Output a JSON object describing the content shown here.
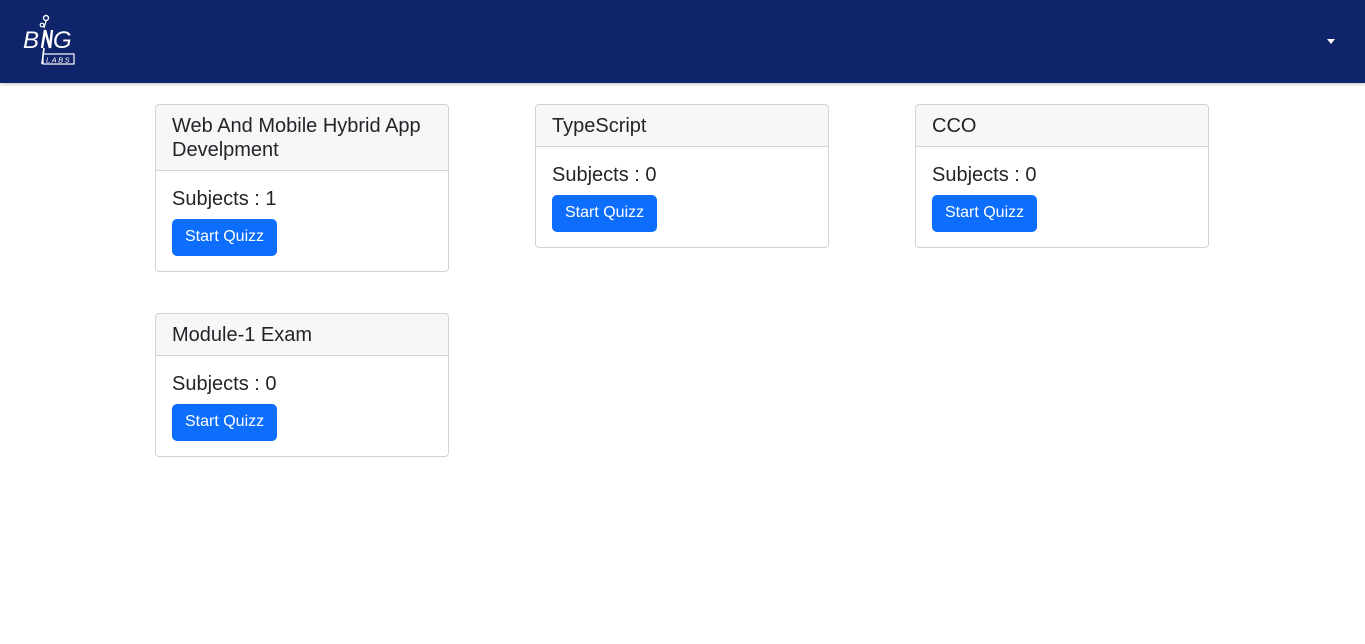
{
  "app": {
    "logo_alt": "BNG LABS"
  },
  "cards": [
    {
      "title": "Web And Mobile Hybrid App Develpment",
      "subjects": "Subjects : 1",
      "button": "Start Quizz"
    },
    {
      "title": "TypeScript",
      "subjects": "Subjects : 0",
      "button": "Start Quizz"
    },
    {
      "title": "CCO",
      "subjects": "Subjects : 0",
      "button": "Start Quizz"
    },
    {
      "title": "Module-1 Exam",
      "subjects": "Subjects : 0",
      "button": "Start Quizz"
    }
  ],
  "colors": {
    "navbar": "#0f246b",
    "button": "#0d6efd"
  }
}
